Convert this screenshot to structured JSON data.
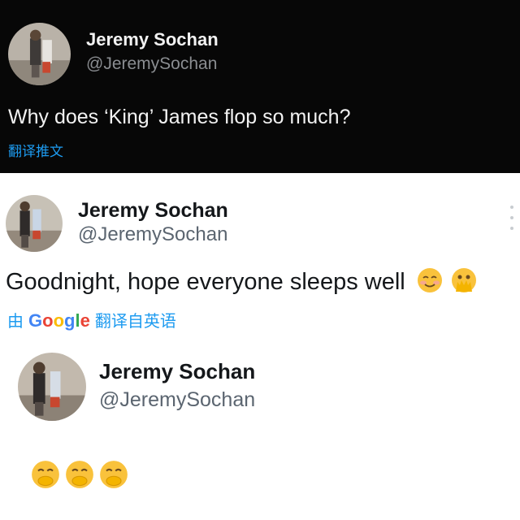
{
  "tweets": [
    {
      "name": "Jeremy Sochan",
      "handle": "@JeremySochan",
      "text": "Why does ‘King’ James flop so much?",
      "translate_label": "翻译推文"
    },
    {
      "name": "Jeremy Sochan",
      "handle": "@JeremySochan",
      "text": "Goodnight, hope everyone sleeps well",
      "text_emojis": [
        "smiling-face-with-blush-emoji",
        "face-with-open-eyes-and-hand-over-mouth-emoji"
      ],
      "translation": {
        "prefix": "由",
        "service": "Google",
        "suffix": "翻译自英语"
      }
    },
    {
      "name": "Jeremy Sochan",
      "handle": "@JeremySochan",
      "emojis": [
        "hand-over-mouth-emoji",
        "hand-over-mouth-emoji",
        "hand-over-mouth-emoji"
      ]
    }
  ],
  "colors": {
    "dark_bg": "#070707",
    "link_blue": "#1d9bf0",
    "emoji_yellow": "#f9c23c"
  }
}
